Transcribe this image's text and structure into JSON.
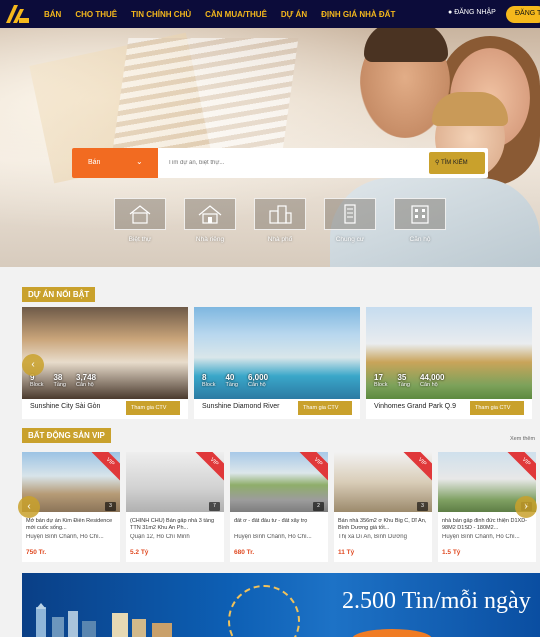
{
  "nav": {
    "items": [
      "BÁN",
      "CHO THUÊ",
      "TIN CHÍNH CHỦ",
      "CẦN MUA/THUÊ",
      "DỰ ÁN",
      "ĐỊNH GIÁ NHÀ ĐẤT"
    ],
    "login": "ĐĂNG NHẬP",
    "register": "ĐĂNG T"
  },
  "search": {
    "type": "Bán",
    "placeholder": "Tìm dự án, biệt thự...",
    "button": "TÌM KIẾM"
  },
  "categories": [
    "Biệt thự",
    "Nhà riêng",
    "Nhà phố",
    "Chung cư",
    "Căn hộ"
  ],
  "projects": {
    "title": "DỰ ÁN NỔI BẬT",
    "join_label": "Tham gia CTV",
    "units": {
      "block": "Block",
      "floor": "Tầng",
      "apt": "Căn hộ"
    },
    "items": [
      {
        "name": "Sunshine City Sài Gòn",
        "block": "9",
        "floors": "38",
        "apartments": "3,748"
      },
      {
        "name": "Sunshine Diamond River",
        "block": "8",
        "floors": "40",
        "apartments": "6,000"
      },
      {
        "name": "Vinhomes Grand Park Q.9",
        "block": "17",
        "floors": "35",
        "apartments": "44,000"
      }
    ]
  },
  "vip": {
    "title": "BẤT ĐỘNG SẢN VIP",
    "see_more": "Xem thêm",
    "ribbon": "VIP",
    "items": [
      {
        "title": "Mở bán dự án Kim Điền Residence mới cuốc sống...",
        "location": "Huyện Bình Chánh, Hồ Chí...",
        "price": "750 Tr.",
        "photos": "3"
      },
      {
        "title": "(CHÍNH CHỦ) Bán gấp nhà 3 tầng TTN 31m2 Khu An Ph...",
        "location": "Quận 12, Hồ Chí Minh",
        "price": "5.2 Tỷ",
        "photos": "7"
      },
      {
        "title": "đất ơ - đất đầu tư - đất xây trọ",
        "location": "Huyện Bình Chánh, Hồ Chí...",
        "price": "680 Tr.",
        "photos": "2"
      },
      {
        "title": "Bán nhà 356m2 ơ Khu Big C, Dĩ An, Bình Dương giá tốt...",
        "location": "Thị xã Dĩ An, Bình Dương",
        "price": "11 Tỷ",
        "photos": "3"
      },
      {
        "title": "nhà bán gấp đinh đức thiện D1XD-98M2 D1SD - 180M2...",
        "location": "Huyện Bình Chánh, Hồ Chí...",
        "price": "1.5 Tỷ",
        "photos": "11"
      }
    ]
  },
  "banner": {
    "headline": "2.500 Tin/mỗi ngày"
  },
  "colors": {
    "navy": "#0c0c3a",
    "gold": "#c9a12c",
    "orange": "#f26b21",
    "price": "#e04a22",
    "vip_ribbon": "#e0383a"
  }
}
